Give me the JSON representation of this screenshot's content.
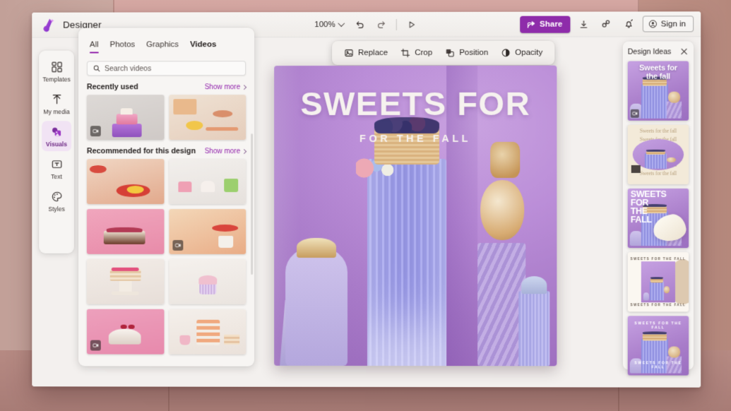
{
  "app": {
    "title": "Designer",
    "logo_icon": "designer-logo-icon"
  },
  "toolbar": {
    "zoom_level": "100%",
    "undo_icon": "undo-icon",
    "redo_icon": "redo-icon",
    "present_icon": "play-present-icon",
    "share_label": "Share",
    "share_icon": "share-icon",
    "download_icon": "download-icon",
    "link_icon": "link-icon",
    "notification_icon": "bell-icon",
    "signin_label": "Sign in",
    "signin_icon": "account-circle-icon",
    "accent_color": "#8e2caa"
  },
  "rail": {
    "items": [
      {
        "label": "Templates",
        "icon": "templates-grid-icon",
        "active": false
      },
      {
        "label": "My media",
        "icon": "upload-arrow-icon",
        "active": false
      },
      {
        "label": "Visuals",
        "icon": "visuals-shapes-icon",
        "active": true
      },
      {
        "label": "Text",
        "icon": "text-box-icon",
        "active": false
      },
      {
        "label": "Styles",
        "icon": "palette-icon",
        "active": false
      }
    ]
  },
  "panel": {
    "tabs": [
      {
        "label": "All",
        "active": true,
        "bold": false
      },
      {
        "label": "Photos",
        "active": false,
        "bold": false
      },
      {
        "label": "Graphics",
        "active": false,
        "bold": false
      },
      {
        "label": "Videos",
        "active": false,
        "bold": true
      }
    ],
    "search": {
      "placeholder": "Search videos",
      "value": "",
      "icon": "search-icon"
    },
    "sections": [
      {
        "title": "Recently used",
        "show_more": "Show more",
        "items": [
          {
            "name": "pink-purple-tiered-cake",
            "is_video": true
          },
          {
            "name": "citrus-on-table-still-life",
            "is_video": false
          }
        ]
      },
      {
        "title": "Recommended for this design",
        "show_more": "Show more",
        "items": [
          {
            "name": "orange-slice-red-plate",
            "is_video": false
          },
          {
            "name": "three-desserts-pastel",
            "is_video": false
          },
          {
            "name": "raspberry-cheesecake-pink",
            "is_video": false
          },
          {
            "name": "croissant-and-mug-table",
            "is_video": true
          },
          {
            "name": "layer-cake-on-stand",
            "is_video": false
          },
          {
            "name": "single-cupcake-white",
            "is_video": false
          },
          {
            "name": "cherry-dome-dessert-pink",
            "is_video": true
          },
          {
            "name": "macaron-tower-tray",
            "is_video": false
          }
        ]
      }
    ]
  },
  "context_toolbar": {
    "items": [
      {
        "label": "Replace",
        "icon": "image-replace-icon"
      },
      {
        "label": "Crop",
        "icon": "crop-icon"
      },
      {
        "label": "Position",
        "icon": "position-layers-icon"
      },
      {
        "label": "Opacity",
        "icon": "opacity-circle-icon"
      }
    ]
  },
  "canvas": {
    "title": "SWEETS FOR",
    "subtitle": "FOR THE FALL",
    "background_color": "#b58ad4",
    "text_color": "#f6f2ef",
    "image_name": "purple-pedestal-dessert-still-life"
  },
  "design_ideas": {
    "title": "Design Ideas",
    "close_icon": "close-icon",
    "items": [
      {
        "name": "idea-sweets-for-the-fall-centered",
        "caption": "Sweets for\nthe fall",
        "has_video_badge": true
      },
      {
        "name": "idea-repeating-serif-oval",
        "caption": "Sweets for the fall",
        "repeat_lines": 6,
        "has_video_badge": false
      },
      {
        "name": "idea-bold-stacked-blob",
        "caption": "SWEETS\nFOR\nTHE\nFALL",
        "has_video_badge": false
      },
      {
        "name": "idea-framed-minimal-bands",
        "caption_top": "SWEETS FOR THE FALL",
        "caption_bottom": "SWEETS FOR THE FALL",
        "has_video_badge": false
      },
      {
        "name": "idea-circular-text-ring",
        "caption_top": "SWEETS FOR THE FALL",
        "caption_bottom": "SWEETS FOR THE FALL",
        "has_video_badge": false
      }
    ]
  }
}
